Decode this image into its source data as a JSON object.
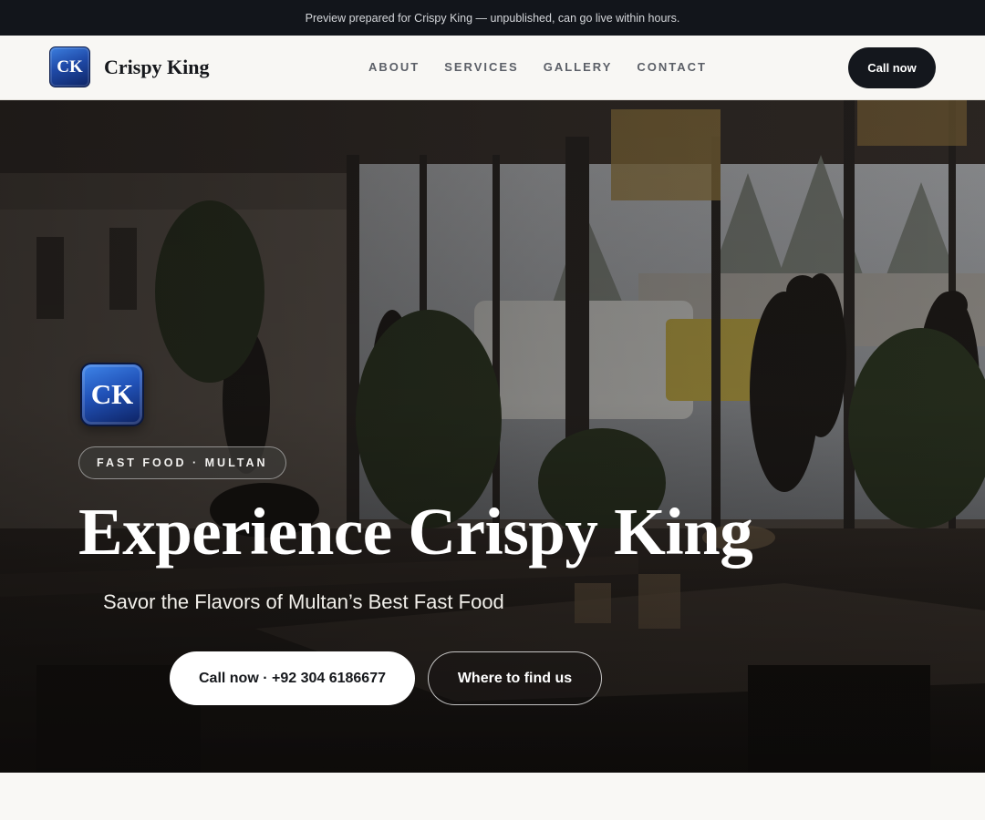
{
  "preview_bar": {
    "text": "Preview prepared for Crispy King — unpublished, can go live within hours."
  },
  "nav": {
    "logo_text": "CK",
    "brand_name": "Crispy King",
    "links": [
      "ABOUT",
      "SERVICES",
      "GALLERY",
      "CONTACT"
    ],
    "cta_label": "Call now"
  },
  "hero": {
    "logo_text": "CK",
    "category_pill": "FAST FOOD · MULTAN",
    "headline": "Experience Crispy King",
    "subheadline": "Savor the Flavors of Multan’s Best Fast Food",
    "primary_button": "Call now · +92 304 6186677",
    "secondary_button": "Where to find us",
    "background_description_icon": "restaurant-interior-photo"
  },
  "colors": {
    "dark": "#12151b",
    "brand_blue": "#2152b8",
    "page_bg": "#f9f8f5"
  }
}
